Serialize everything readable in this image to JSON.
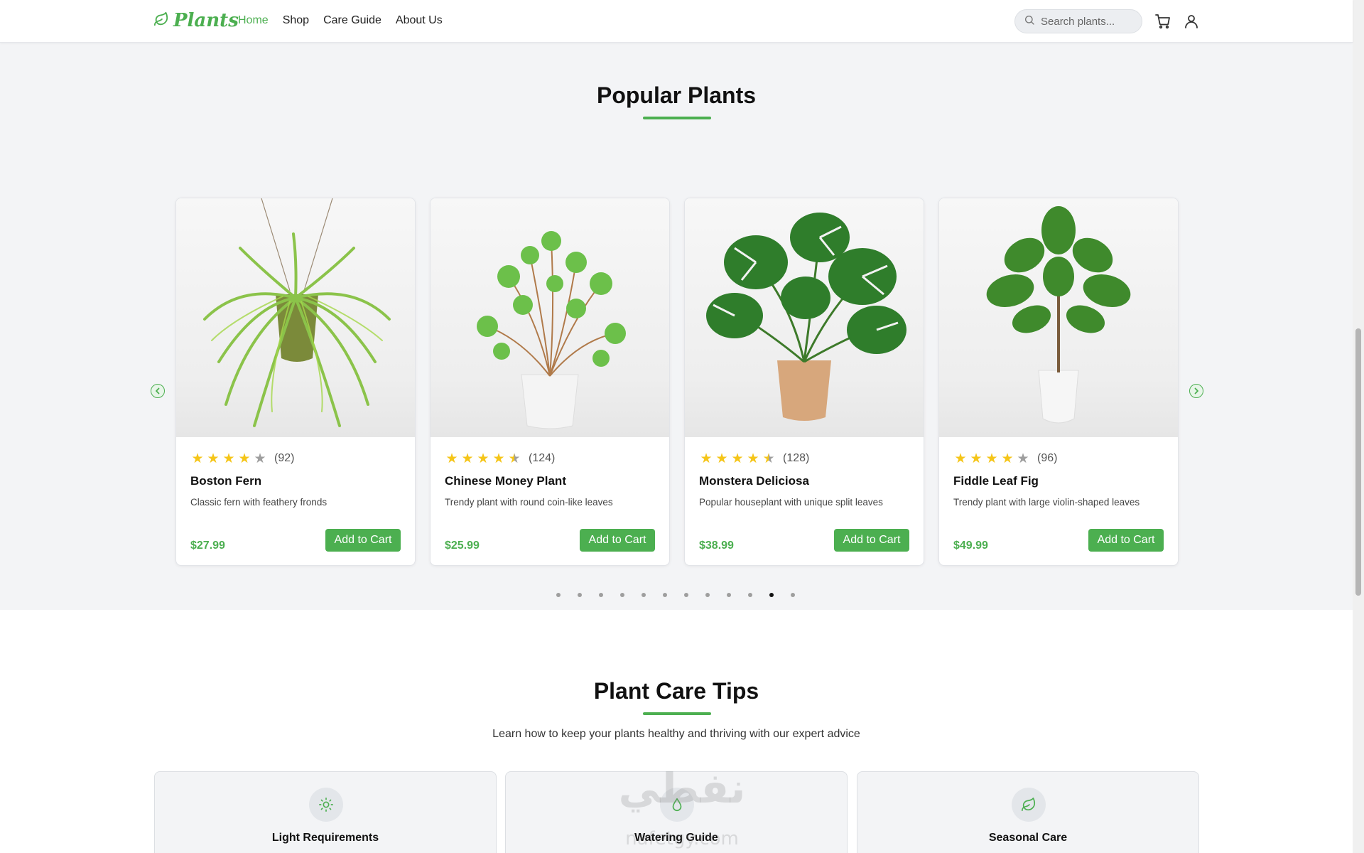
{
  "header": {
    "logo_text": "Plants",
    "nav": [
      {
        "label": "Home",
        "active": true
      },
      {
        "label": "Shop",
        "active": false
      },
      {
        "label": "Care Guide",
        "active": false
      },
      {
        "label": "About Us",
        "active": false
      }
    ],
    "search_placeholder": "Search plants...",
    "icons": [
      "leaf-icon",
      "search-icon",
      "cart-icon",
      "user-icon"
    ]
  },
  "popular": {
    "title": "Popular Plants",
    "products": [
      {
        "name": "Boston Fern",
        "description": "Classic fern with feathery fronds",
        "price": "$27.99",
        "rating": 4,
        "reviews": "(92)",
        "button": "Add to Cart"
      },
      {
        "name": "Chinese Money Plant",
        "description": "Trendy plant with round coin-like leaves",
        "price": "$25.99",
        "rating": 4.5,
        "reviews": "(124)",
        "button": "Add to Cart"
      },
      {
        "name": "Monstera Deliciosa",
        "description": "Popular houseplant with unique split leaves",
        "price": "$38.99",
        "rating": 4.5,
        "reviews": "(128)",
        "button": "Add to Cart"
      },
      {
        "name": "Fiddle Leaf Fig",
        "description": "Trendy plant with large violin-shaped leaves",
        "price": "$49.99",
        "rating": 4,
        "reviews": "(96)",
        "button": "Add to Cart"
      }
    ],
    "carousel": {
      "page_count": 12,
      "active_index": 10
    }
  },
  "care": {
    "title": "Plant Care Tips",
    "subtitle": "Learn how to keep your plants healthy and thriving with our expert advice",
    "tips": [
      {
        "title": "Light Requirements",
        "icon": "sun-icon"
      },
      {
        "title": "Watering Guide",
        "icon": "water-drop-icon"
      },
      {
        "title": "Seasonal Care",
        "icon": "leaf-icon"
      }
    ]
  },
  "watermark": {
    "text": "نفطي",
    "subtext": "nafetgy.com"
  },
  "colors": {
    "accent": "#4caf50",
    "star": "#f5c518",
    "background": "#f3f4f6"
  }
}
